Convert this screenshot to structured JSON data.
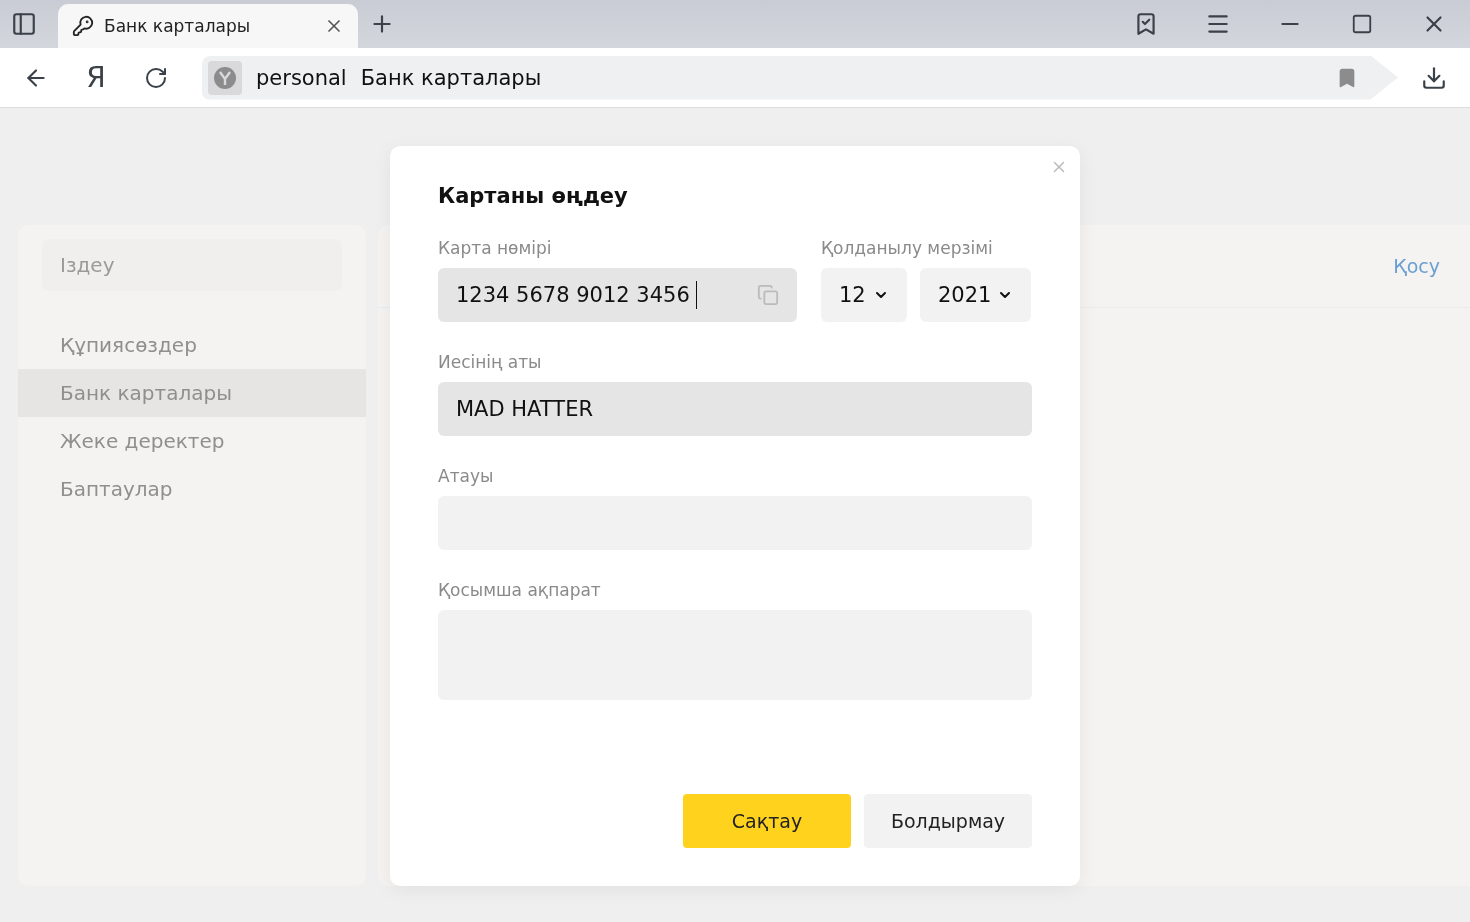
{
  "browser": {
    "tab": {
      "title": "Банк карталары",
      "selected": true
    },
    "logo": "Я",
    "address": {
      "site": "personal",
      "page": "Банк карталары"
    }
  },
  "sidebar": {
    "search": {
      "placeholder": "Іздеу"
    },
    "items": [
      {
        "label": "Құпиясөздер",
        "selected": false
      },
      {
        "label": "Банк карталары",
        "selected": true
      },
      {
        "label": "Жеке деректер",
        "selected": false
      },
      {
        "label": "Баптаулар",
        "selected": false
      }
    ]
  },
  "main": {
    "add_link": "Қосу"
  },
  "dialog": {
    "title": "Картаны өңдеу",
    "card_number": {
      "label": "Карта нөмірі",
      "value": "1234 5678 9012 3456",
      "focused": true
    },
    "expiry": {
      "label": "Қолданылу мерзімі",
      "month": "12",
      "year": "2021"
    },
    "fields": [
      {
        "label": "Иесінің аты",
        "value": "MAD HATTER",
        "kind": "input"
      },
      {
        "label": "Атауы",
        "kind": "input"
      },
      {
        "label": "Қосымша ақпарат",
        "kind": "textarea"
      }
    ],
    "buttons": [
      {
        "label": "Сақтау",
        "kind": "primary"
      },
      {
        "label": "Болдырмау",
        "kind": "secondary"
      }
    ]
  }
}
